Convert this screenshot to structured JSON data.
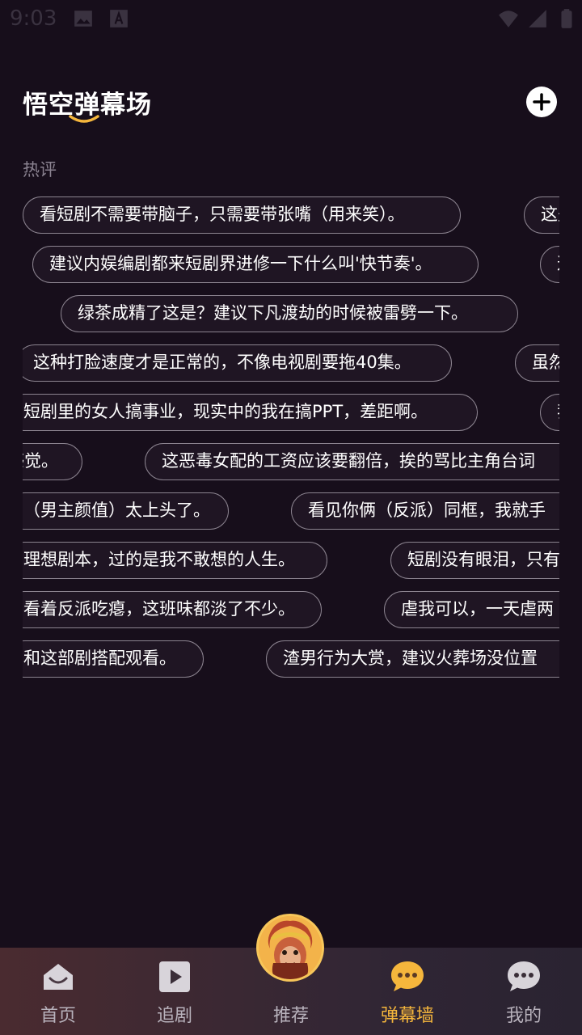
{
  "status": {
    "time": "9:03"
  },
  "header": {
    "title": "悟空弹幕场"
  },
  "section": {
    "label": "热评"
  },
  "rows": [
    [
      {
        "text": "看短剧不需要带脑子，只需要带张嘴（用来笑）。",
        "l": 0,
        "w": 542
      },
      {
        "text": "这是",
        "l": 620,
        "w": 120
      }
    ],
    [
      {
        "text": "建议内娱编剧都来短剧界进修一下什么叫'快节奏'。",
        "l": 12,
        "w": 552
      },
      {
        "text": "这",
        "l": 640,
        "w": 120
      }
    ],
    [
      {
        "text": "绿茶成精了这是？建议下凡渡劫的时候被雷劈一下。",
        "l": 47,
        "w": 566
      }
    ],
    [
      {
        "text": "这种打脸速度才是正常的，不像电视剧要拖40集。",
        "l": -8,
        "w": 539
      },
      {
        "text": "虽然",
        "l": 609,
        "w": 120
      }
    ],
    [
      {
        "text": "短剧里的女人搞事业，现实中的我在搞PPT，差距啊。",
        "l": -20,
        "w": 583
      },
      {
        "text": "我",
        "l": 640,
        "w": 120
      }
    ],
    [
      {
        "text": "感觉。",
        "l": -40,
        "w": 114
      },
      {
        "text": "这恶毒女配的工资应该要翻倍，挨的骂比主角台词",
        "l": 151,
        "w": 560
      }
    ],
    [
      {
        "text": "（男主颜值）太上头了。",
        "l": -20,
        "w": 275
      },
      {
        "text": "看见你俩（反派）同框，我就手",
        "l": 332,
        "w": 380
      }
    ],
    [
      {
        "text": "理想剧本，过的是我不敢想的人生。",
        "l": -20,
        "w": 397
      },
      {
        "text": "短剧没有眼泪，只有",
        "l": 455,
        "w": 260
      }
    ],
    [
      {
        "text": "看着反派吃瘪，这班味都淡了不少。",
        "l": -20,
        "w": 390
      },
      {
        "text": "虐我可以，一天虐两",
        "l": 447,
        "w": 260
      }
    ],
    [
      {
        "text": "和这部剧搭配观看。",
        "l": -20,
        "w": 244
      },
      {
        "text": "渣男行为大赏，建议火葬场没位置",
        "l": 301,
        "w": 400
      }
    ]
  ],
  "nav": [
    {
      "label": "首页",
      "icon": "home-icon"
    },
    {
      "label": "追剧",
      "icon": "play-icon"
    },
    {
      "label": "推荐",
      "icon": "avatar-icon"
    },
    {
      "label": "弹幕墙",
      "icon": "danmaku-chat-icon"
    },
    {
      "label": "我的",
      "icon": "chat-bubble-icon"
    }
  ],
  "colors": {
    "accent": "#f5b63c",
    "background": "#170e1b",
    "pill_border": "#8c8490"
  }
}
